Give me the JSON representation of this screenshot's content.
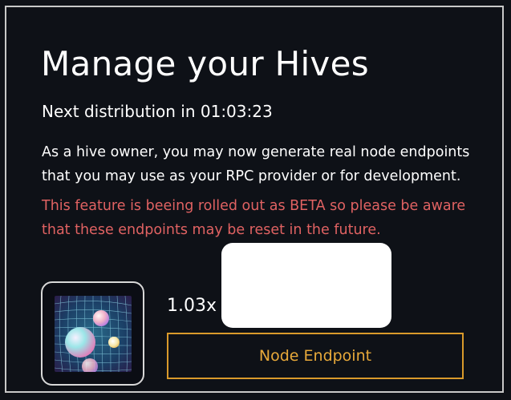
{
  "page": {
    "title": "Manage your Hives",
    "next_distribution": "Next distribution in 01:03:23",
    "description": "As a hive owner, you may now generate real node endpoints that you may use as your RPC provider or for development.",
    "warning": "This feature is beeing rolled out as BETA so please be aware that these endpoints may be reset in the future."
  },
  "hive": {
    "multiplier": "1.03x",
    "button_label": "Node Endpoint",
    "image_icon": "hive-nft-artwork"
  },
  "colors": {
    "background": "#0e1117",
    "text": "#ffffff",
    "warning": "#e06262",
    "button_border": "#d99a2b",
    "button_text": "#e8a93a"
  }
}
